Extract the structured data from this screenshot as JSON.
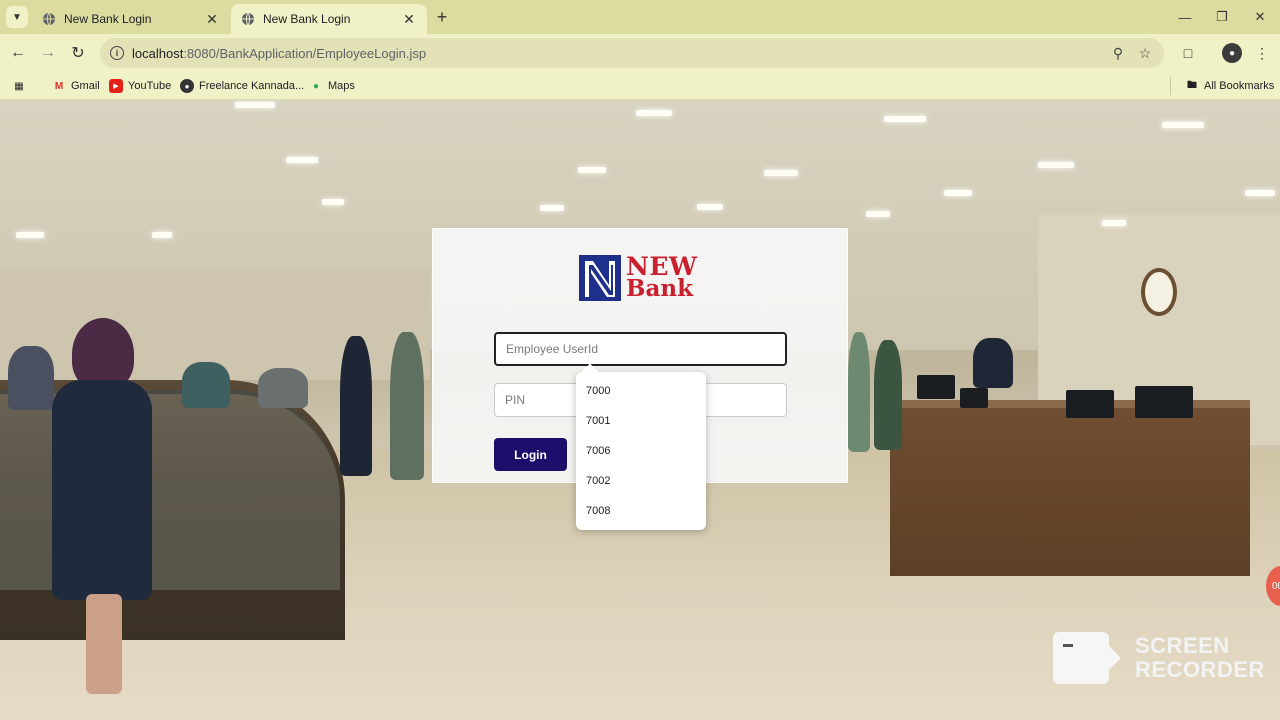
{
  "browser": {
    "tabs": [
      {
        "title": "New Bank Login",
        "active": false
      },
      {
        "title": "New Bank Login",
        "active": true
      }
    ],
    "new_tab_symbol": "+",
    "address": {
      "host": "localhost",
      "path": ":8080/BankApplication/EmployeeLogin.jsp"
    },
    "bookmarks": [
      {
        "label": "Gmail",
        "icon": "gmail-icon"
      },
      {
        "label": "YouTube",
        "icon": "youtube-icon"
      },
      {
        "label": "Freelance Kannada...",
        "icon": "globe-icon"
      },
      {
        "label": "Maps",
        "icon": "maps-icon"
      }
    ],
    "all_bookmarks_label": "All Bookmarks",
    "colors": {
      "frame": "#dcdca0",
      "toolbar": "#f1f1c7"
    }
  },
  "login": {
    "logo": {
      "line1": "NEW",
      "line2": "Bank",
      "brand_color": "#c8202e",
      "mark_color": "#1e2f8c"
    },
    "userid_placeholder": "Employee UserId",
    "pin_placeholder": "PIN",
    "login_button": "Login",
    "button_color": "#1b0f6b",
    "autocomplete": [
      "7000",
      "7001",
      "7006",
      "7002",
      "7008"
    ]
  },
  "overlay": {
    "recorder_badge": "00",
    "watermark_line1": "SCREEN",
    "watermark_line2": "RECORDER"
  }
}
